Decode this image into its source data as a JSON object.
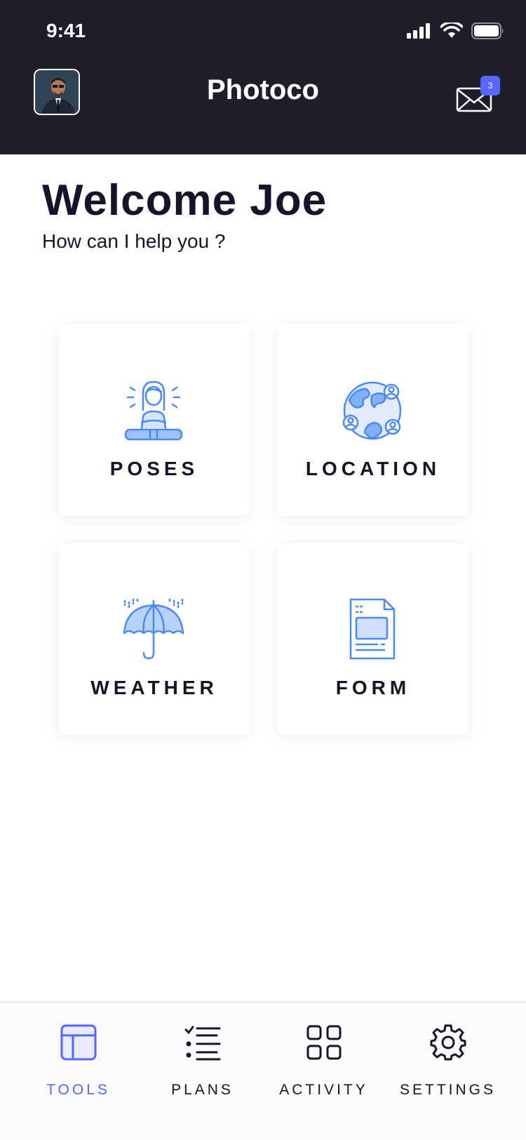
{
  "status_bar": {
    "time": "9:41"
  },
  "header": {
    "title": "Photoco",
    "mail_badge_count": "3"
  },
  "welcome": {
    "title": "Welcome Joe",
    "subtitle": "How can I help you ?"
  },
  "cards": [
    {
      "label": "POSES",
      "icon": "meditation-person-icon"
    },
    {
      "label": "LOCATION",
      "icon": "globe-users-icon"
    },
    {
      "label": "WEATHER",
      "icon": "umbrella-rain-icon"
    },
    {
      "label": "FORM",
      "icon": "document-form-icon"
    }
  ],
  "tabbar": {
    "items": [
      {
        "label": "TOOLS",
        "icon": "layout-icon",
        "active": true
      },
      {
        "label": "PLANS",
        "icon": "checklist-icon",
        "active": false
      },
      {
        "label": "ACTIVITY",
        "icon": "grid-icon",
        "active": false
      },
      {
        "label": "SETTINGS",
        "icon": "gear-icon",
        "active": false
      }
    ]
  },
  "colors": {
    "header_bg": "#1f1f2b",
    "accent": "#5468ff",
    "icon_blue": "#4a8af4",
    "text_dark": "#15142a"
  }
}
